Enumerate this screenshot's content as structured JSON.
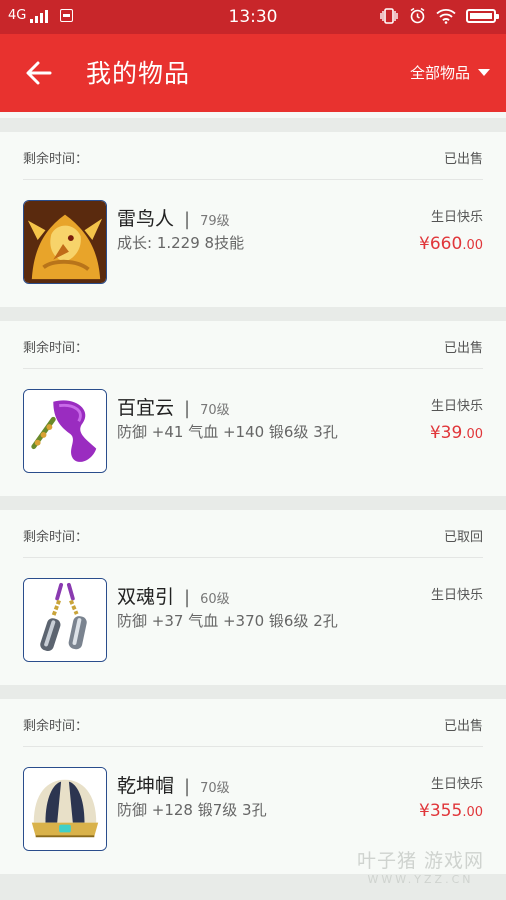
{
  "status_bar": {
    "network": "4G",
    "time": "13:30"
  },
  "header": {
    "back_icon": "arrow-left-icon",
    "title": "我的物品",
    "filter_label": "全部物品"
  },
  "items": [
    {
      "remaining_label": "剩余时间：",
      "status": "已出售",
      "name": "雷鸟人",
      "level": "79级",
      "desc": "成长: 1.229  8技能",
      "seller": "生日快乐",
      "price_main": "¥660",
      "price_cents": ".00",
      "icon": "thunderbird-icon"
    },
    {
      "remaining_label": "剩余时间：",
      "status": "已出售",
      "name": "百宜云",
      "level": "70级",
      "desc": "防御 +41 气血 +140  锻6级  3孔",
      "seller": "生日快乐",
      "price_main": "¥39",
      "price_cents": ".00",
      "icon": "ribbon-ornament-icon"
    },
    {
      "remaining_label": "剩余时间：",
      "status": "已取回",
      "name": "双魂引",
      "level": "60级",
      "desc": "防御 +37 气血 +370  锻6级  2孔",
      "seller": "生日快乐",
      "price_main": "",
      "price_cents": "",
      "icon": "twin-pendant-icon"
    },
    {
      "remaining_label": "剩余时间：",
      "status": "已出售",
      "name": "乾坤帽",
      "level": "70级",
      "desc": "防御 +128  锻7级  3孔",
      "seller": "生日快乐",
      "price_main": "¥355",
      "price_cents": ".00",
      "icon": "helmet-icon"
    }
  ],
  "watermark": {
    "main": "叶子猪 游戏网",
    "sub": "WWW.YZZ.CN"
  },
  "colors": {
    "status_bar": "#c8262a",
    "app_bar": "#e8322f",
    "price": "#e0363a",
    "thumb_border": "#2a4d8c"
  }
}
